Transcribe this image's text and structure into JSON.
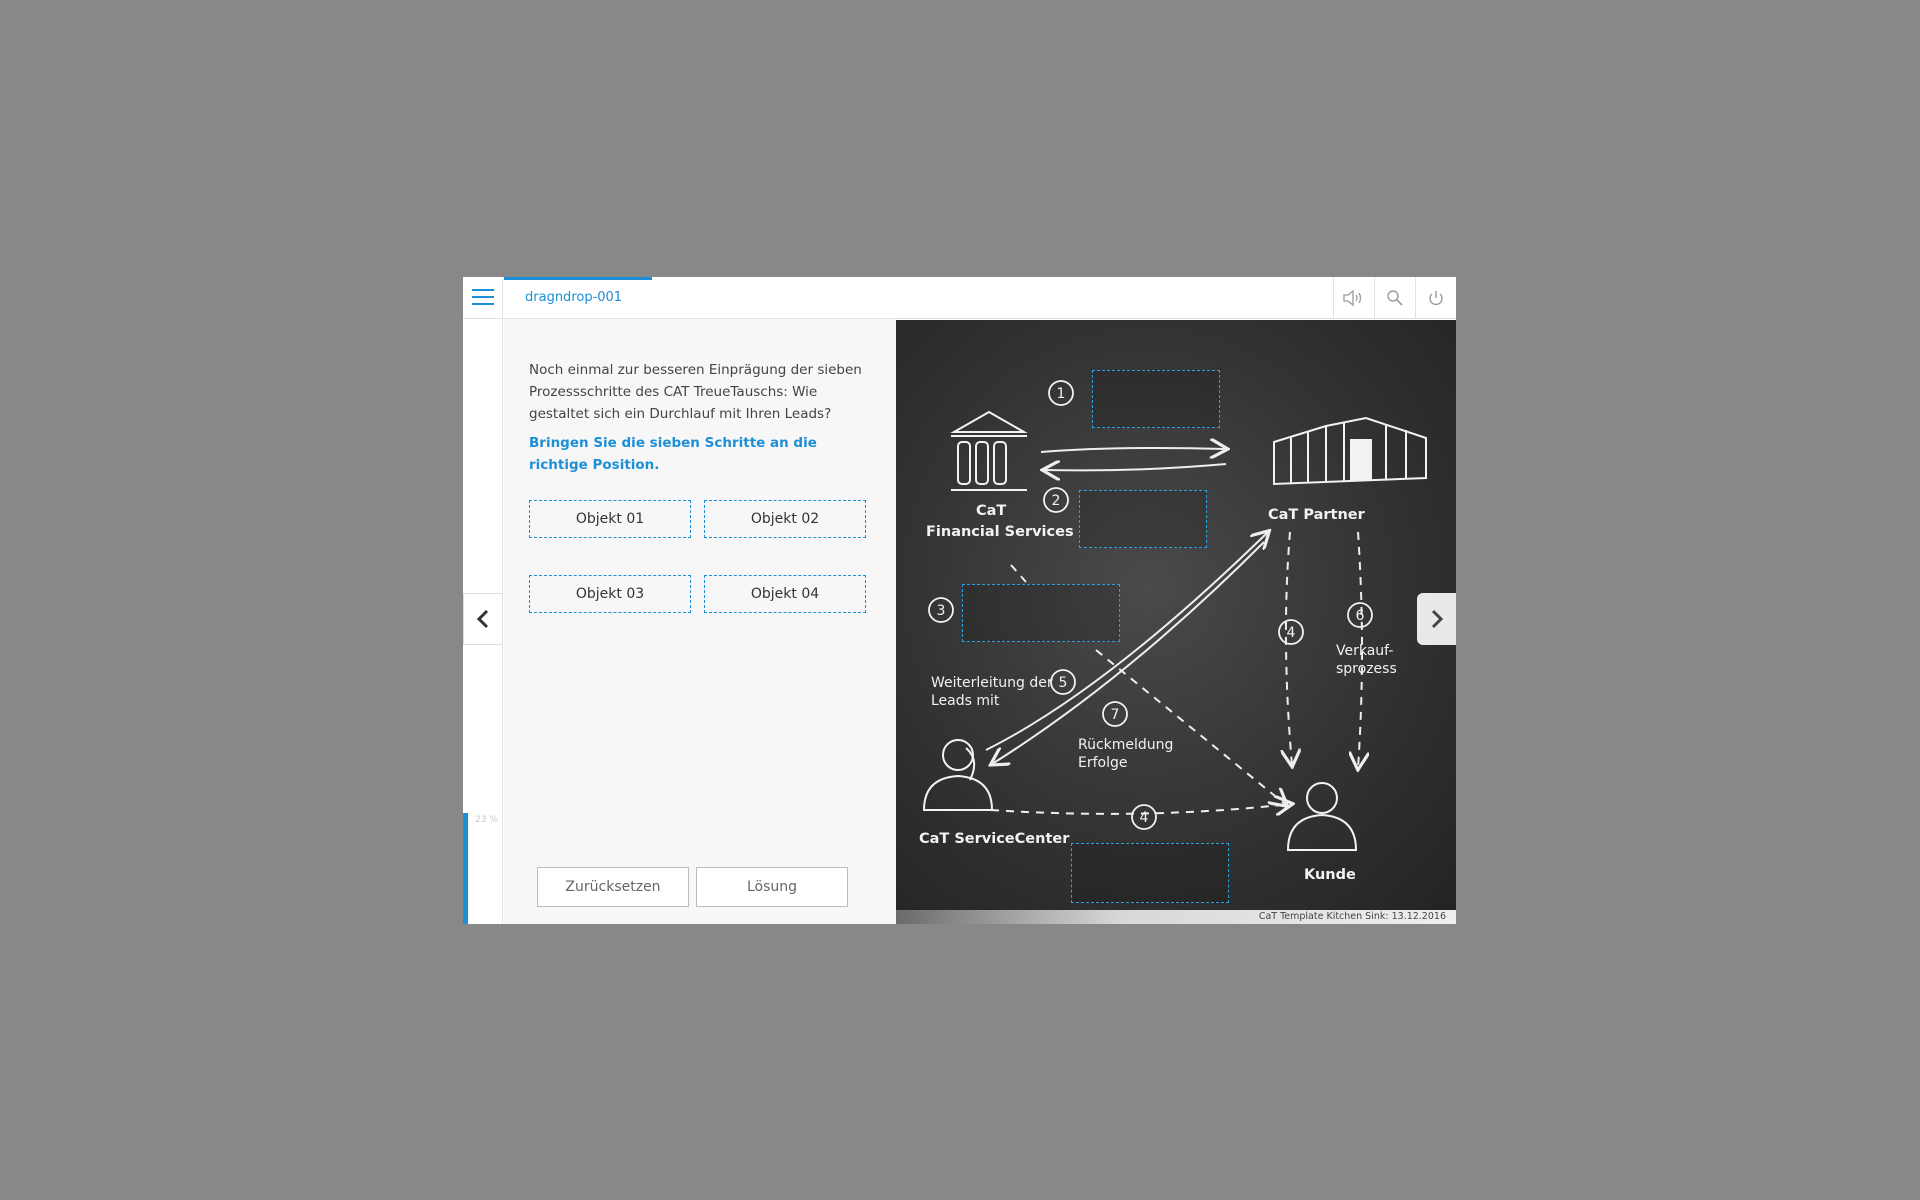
{
  "header": {
    "tab_label": "dragndrop-001",
    "menu_icon": "hamburger-menu-icon",
    "audio_icon": "speaker-icon",
    "search_icon": "search-icon",
    "power_icon": "power-icon"
  },
  "sidebar": {
    "progress_text": "23 %",
    "progress_value": 0.23
  },
  "content": {
    "question": "Noch einmal zur besseren Einprägung der sieben Prozessschritte des CAT TreueTauschs: Wie gestaltet sich ein Durchlauf mit Ihren Leads?",
    "instruction": "Bringen Sie die sieben Schritte an die richtige Position.",
    "objects": [
      "Objekt 01",
      "Objekt 02",
      "Objekt 03",
      "Objekt 04"
    ],
    "reset_label": "Zurücksetzen",
    "solution_label": "Lösung"
  },
  "diagram": {
    "cat_fs_line1": "CaT",
    "cat_fs_line2": "Financial Services",
    "cat_partner": "CaT Partner",
    "service_center": "CaT ServiceCenter",
    "kunde": "Kunde",
    "weiterleitung_1": "Weiterleitung der",
    "weiterleitung_2": "Leads mit",
    "rueckmeldung_1": "Rückmeldung",
    "rueckmeldung_2": "Erfolge",
    "verkauf_1": "Verkauf-",
    "verkauf_2": "sprozess",
    "step_numbers": [
      "1",
      "2",
      "3",
      "4",
      "5",
      "6",
      "7",
      "4"
    ]
  },
  "footer": {
    "version": "CaT Template Kitchen Sink: 13.12.2016"
  },
  "colors": {
    "accent": "#1c8fd6",
    "backdrop": "#888888",
    "chalk": "#f2f2f2"
  }
}
